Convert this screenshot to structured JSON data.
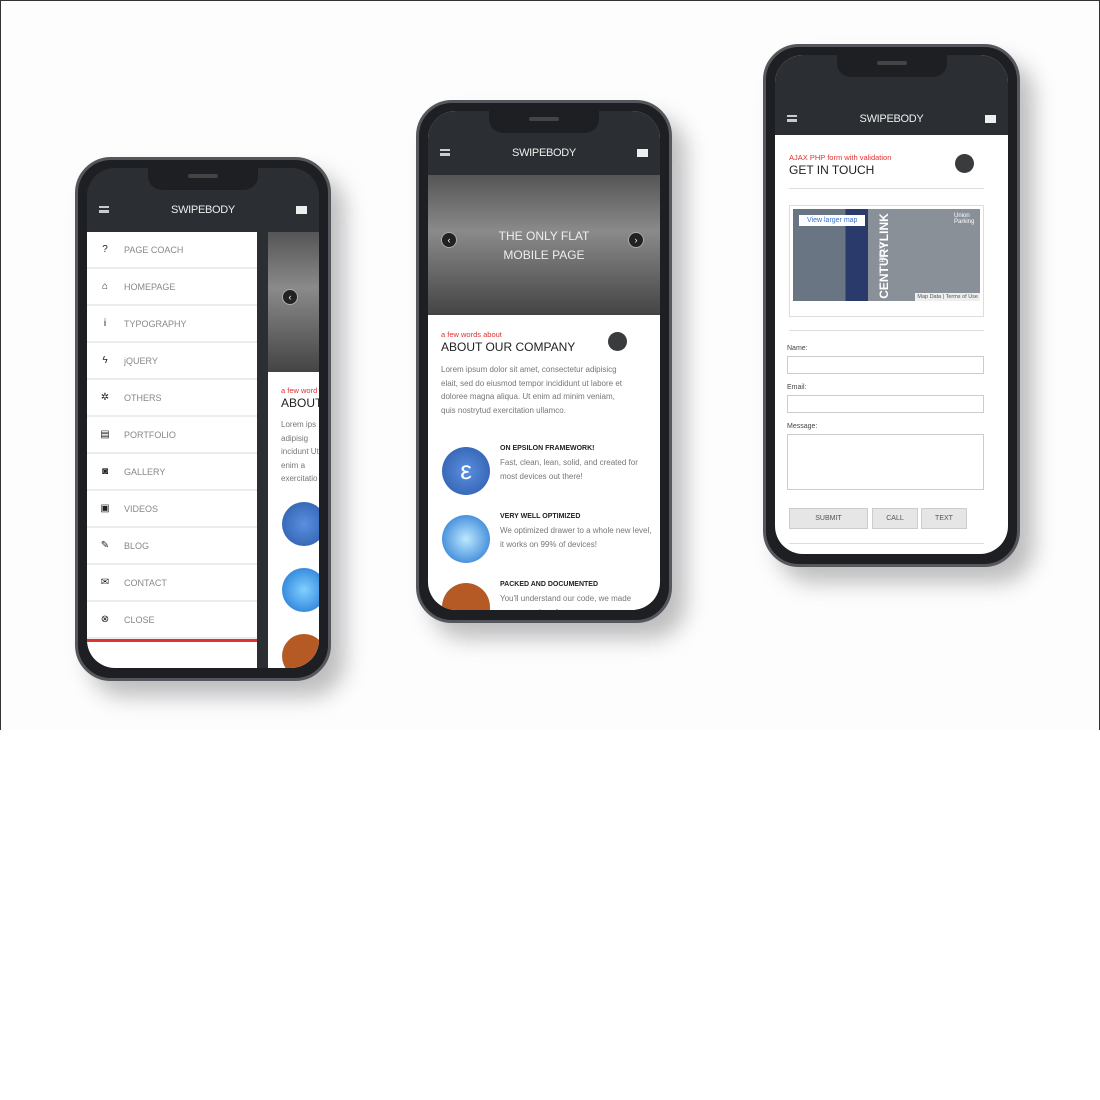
{
  "app_title": "SWIPEBODY",
  "phone1": {
    "menu": [
      {
        "label": "PAGE COACH",
        "icon": "question-icon",
        "glyph": "?"
      },
      {
        "label": "HOMEPAGE",
        "icon": "home-icon",
        "glyph": "⌂"
      },
      {
        "label": "TYPOGRAPHY",
        "icon": "info-icon",
        "glyph": "i"
      },
      {
        "label": "jQUERY",
        "icon": "bolt-icon",
        "glyph": "ϟ"
      },
      {
        "label": "OTHERS",
        "icon": "gear-icon",
        "glyph": "✲"
      },
      {
        "label": "PORTFOLIO",
        "icon": "clapperboard-icon",
        "glyph": "▤"
      },
      {
        "label": "GALLERY",
        "icon": "camera-icon",
        "glyph": "◙"
      },
      {
        "label": "VIDEOS",
        "icon": "film-icon",
        "glyph": "▣"
      },
      {
        "label": "BLOG",
        "icon": "pencil-icon",
        "glyph": "✎"
      },
      {
        "label": "CONTACT",
        "icon": "mail-icon",
        "glyph": "✉"
      },
      {
        "label": "CLOSE",
        "icon": "close-icon",
        "glyph": "⊗"
      }
    ],
    "peek_subtitle": "a few word",
    "peek_title": "ABOUT",
    "peek_text": "Lorem ips adipisig incidunt Ut enim a exercitatio"
  },
  "phone2": {
    "hero_line1": "THE ONLY FLAT",
    "hero_line2": "MOBILE PAGE",
    "subtitle": "a few words about",
    "title": "ABOUT OUR COMPANY",
    "body": "Lorem ipsum dolor sit amet, consectetur adipisicg elait, sed do eiusmod tempor incididunt ut labore et doloree magna aliqua. Ut enim ad minim veniam, quis nostrytud exercitation ullamco.",
    "features": [
      {
        "title": "ON EPSILON FRAMEWORK!",
        "text": "Fast, clean, lean, solid, and created for most devices out there!"
      },
      {
        "title": "VERY WELL OPTIMIZED",
        "text": "We optimized drawer to a whole new level, it works on 99% of devices!"
      },
      {
        "title": "PACKED AND DOCUMENTED",
        "text": "You'll understand our code, we made awesome docs for"
      }
    ]
  },
  "phone3": {
    "subtitle": "AJAX PHP form with validation",
    "title": "GET IN TOUCH",
    "map": {
      "link": "View larger map",
      "label1": "CENTURYLINK",
      "label2": "FIELD",
      "parking": "Union Parking",
      "footer": "Map Data | Terms of Use"
    },
    "name_label": "Name:",
    "email_label": "Email:",
    "message_label": "Message:",
    "buttons": [
      "SUBMIT",
      "CALL",
      "TEXT"
    ]
  },
  "colors": {
    "accent": "#dd3333",
    "header": "#2b2e33"
  }
}
